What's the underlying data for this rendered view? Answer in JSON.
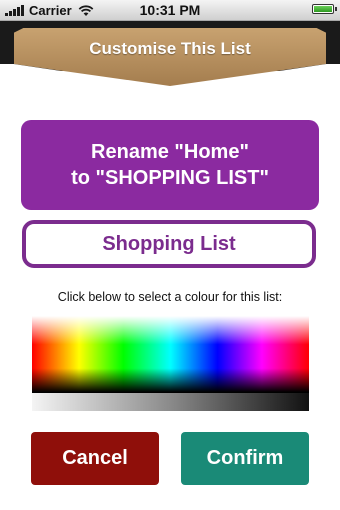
{
  "status_bar": {
    "carrier": "Carrier",
    "time": "10:31 PM",
    "signal_icon": "signal-bars-icon",
    "wifi_icon": "wifi-icon",
    "battery_icon": "battery-icon",
    "battery_level": 1.0
  },
  "header": {
    "title": "Customise This List",
    "color": "#b48d5c"
  },
  "rename_button": {
    "line1": "Rename \"Home\"",
    "line2": "to \"SHOPPING LIST\"",
    "color": "#8b2aa0"
  },
  "name_field": {
    "value": "Shopping List",
    "color": "#7b2c8e"
  },
  "colour_picker": {
    "instruction": "Click below to select a colour for this list:"
  },
  "actions": {
    "cancel_label": "Cancel",
    "cancel_color": "#8f0f0a",
    "confirm_label": "Confirm",
    "confirm_color": "#1a8a77"
  }
}
